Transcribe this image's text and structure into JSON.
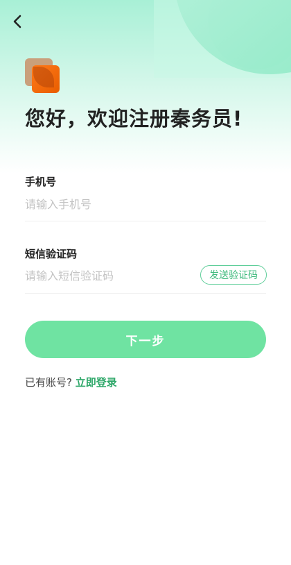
{
  "header": {
    "back_icon": "chevron-left-icon",
    "logo_icon": "app-logo"
  },
  "title": "您好，欢迎注册秦务员!",
  "form": {
    "phone": {
      "label": "手机号",
      "value": "",
      "placeholder": "请输入手机号"
    },
    "sms_code": {
      "label": "短信验证码",
      "value": "",
      "placeholder": "请输入短信验证码",
      "send_button": "发送验证码"
    },
    "next_button": "下一步"
  },
  "footer": {
    "prompt": "已有账号?",
    "login_link": "立即登录"
  },
  "colors": {
    "accent": "#6fe3a2",
    "link": "#2fa86a",
    "logo_orange": "#ff7a1a"
  }
}
